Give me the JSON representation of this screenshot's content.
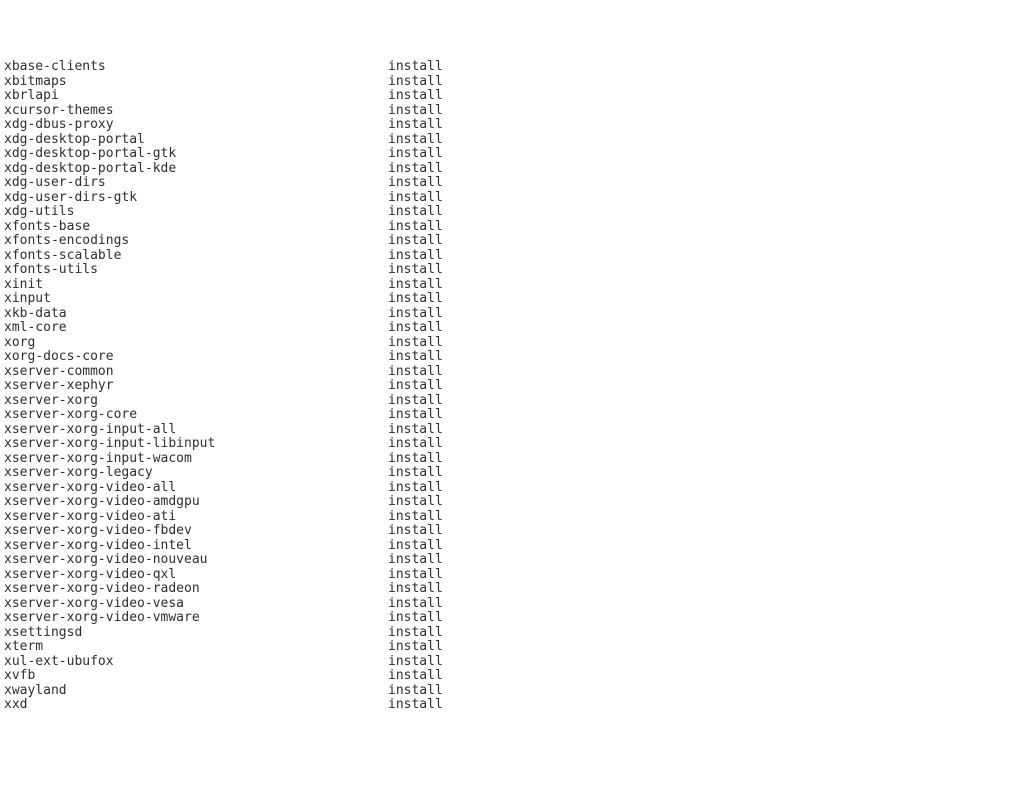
{
  "rows": [
    {
      "pkg": "xbase-clients",
      "status": "install"
    },
    {
      "pkg": "xbitmaps",
      "status": "install"
    },
    {
      "pkg": "xbrlapi",
      "status": "install"
    },
    {
      "pkg": "xcursor-themes",
      "status": "install"
    },
    {
      "pkg": "xdg-dbus-proxy",
      "status": "install"
    },
    {
      "pkg": "xdg-desktop-portal",
      "status": "install"
    },
    {
      "pkg": "xdg-desktop-portal-gtk",
      "status": "install"
    },
    {
      "pkg": "xdg-desktop-portal-kde",
      "status": "install"
    },
    {
      "pkg": "xdg-user-dirs",
      "status": "install"
    },
    {
      "pkg": "xdg-user-dirs-gtk",
      "status": "install"
    },
    {
      "pkg": "xdg-utils",
      "status": "install"
    },
    {
      "pkg": "xfonts-base",
      "status": "install"
    },
    {
      "pkg": "xfonts-encodings",
      "status": "install"
    },
    {
      "pkg": "xfonts-scalable",
      "status": "install"
    },
    {
      "pkg": "xfonts-utils",
      "status": "install"
    },
    {
      "pkg": "xinit",
      "status": "install"
    },
    {
      "pkg": "xinput",
      "status": "install"
    },
    {
      "pkg": "xkb-data",
      "status": "install"
    },
    {
      "pkg": "xml-core",
      "status": "install"
    },
    {
      "pkg": "xorg",
      "status": "install"
    },
    {
      "pkg": "xorg-docs-core",
      "status": "install"
    },
    {
      "pkg": "xserver-common",
      "status": "install"
    },
    {
      "pkg": "xserver-xephyr",
      "status": "install"
    },
    {
      "pkg": "xserver-xorg",
      "status": "install"
    },
    {
      "pkg": "xserver-xorg-core",
      "status": "install"
    },
    {
      "pkg": "xserver-xorg-input-all",
      "status": "install"
    },
    {
      "pkg": "xserver-xorg-input-libinput",
      "status": "install"
    },
    {
      "pkg": "xserver-xorg-input-wacom",
      "status": "install"
    },
    {
      "pkg": "xserver-xorg-legacy",
      "status": "install"
    },
    {
      "pkg": "xserver-xorg-video-all",
      "status": "install"
    },
    {
      "pkg": "xserver-xorg-video-amdgpu",
      "status": "install"
    },
    {
      "pkg": "xserver-xorg-video-ati",
      "status": "install"
    },
    {
      "pkg": "xserver-xorg-video-fbdev",
      "status": "install"
    },
    {
      "pkg": "xserver-xorg-video-intel",
      "status": "install"
    },
    {
      "pkg": "xserver-xorg-video-nouveau",
      "status": "install"
    },
    {
      "pkg": "xserver-xorg-video-qxl",
      "status": "install"
    },
    {
      "pkg": "xserver-xorg-video-radeon",
      "status": "install"
    },
    {
      "pkg": "xserver-xorg-video-vesa",
      "status": "install"
    },
    {
      "pkg": "xserver-xorg-video-vmware",
      "status": "install"
    },
    {
      "pkg": "xsettingsd",
      "status": "install"
    },
    {
      "pkg": "xterm",
      "status": "install"
    },
    {
      "pkg": "xul-ext-ubufox",
      "status": "install"
    },
    {
      "pkg": "xvfb",
      "status": "install"
    },
    {
      "pkg": "xwayland",
      "status": "install"
    },
    {
      "pkg": "xxd",
      "status": "install"
    }
  ]
}
